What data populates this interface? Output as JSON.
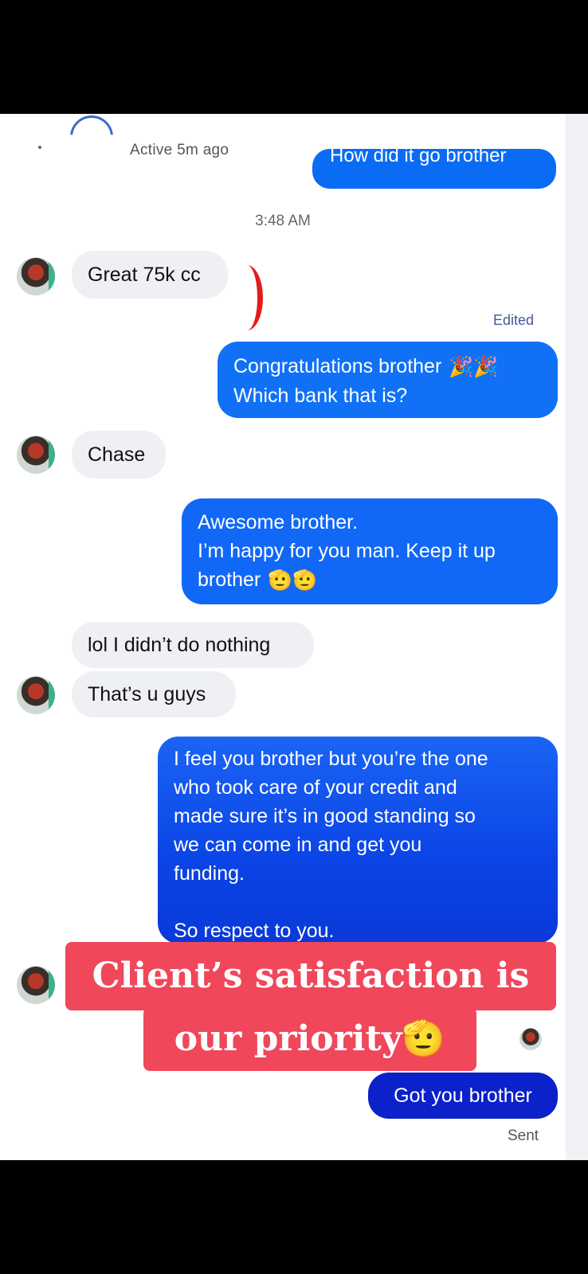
{
  "header": {
    "active_status": "Active 5m ago",
    "top_message_fragment": "How did it go brother"
  },
  "conversation": {
    "timestamp": "3:48 AM",
    "messages": [
      {
        "from": "them",
        "text": "Great 75k cc"
      },
      {
        "from": "me",
        "label": "Edited",
        "lines": [
          "Congratulations brother",
          "Which bank that is?"
        ],
        "emoji": "🎉🎉"
      },
      {
        "from": "them",
        "text": "Chase"
      },
      {
        "from": "me",
        "lines": [
          "Awesome brother.",
          "I’m happy for you man. Keep it up",
          "brother"
        ],
        "emoji": "🫡🫡"
      },
      {
        "from": "them",
        "text": "lol I didn’t do nothing"
      },
      {
        "from": "them",
        "text": "That’s u guys"
      },
      {
        "from": "me",
        "lines": [
          "I feel you brother but you’re the one",
          "who took care of your credit and",
          "made sure it’s in good standing so",
          "we can come in and get you",
          "funding.",
          "",
          "So respect to you."
        ]
      },
      {
        "from": "me",
        "text": "Got you brother"
      }
    ],
    "sent_status": "Sent"
  },
  "overlay": {
    "line1": "Client’s satisfaction is",
    "line2": "our priority",
    "emoji": "🫡"
  },
  "colors": {
    "sent_bubble": "#1071f7",
    "sent_bubble_dark": "#0b21c9",
    "received_bubble": "#eef0f3",
    "banner": "#f0475a",
    "annotation": "#e31b1b"
  }
}
